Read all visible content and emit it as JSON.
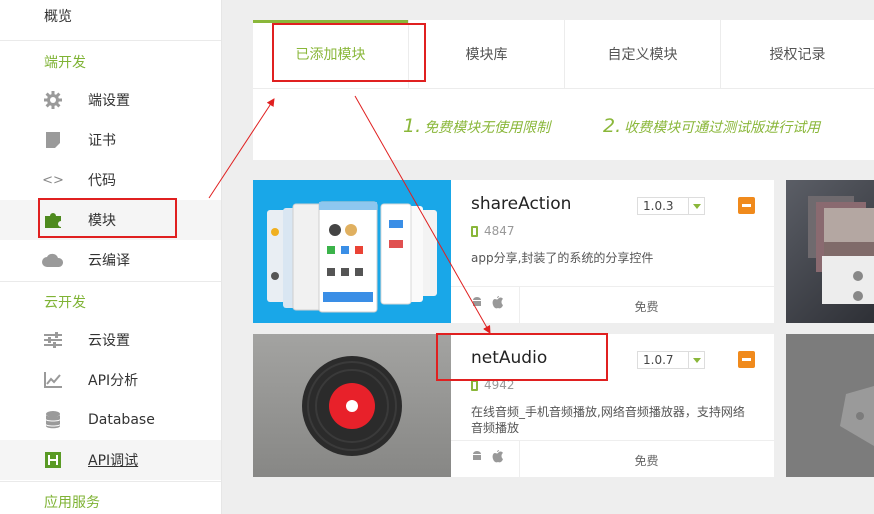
{
  "sidebar": {
    "top_item": "概览",
    "sections": {
      "device": "端开发",
      "cloud": "云开发",
      "services": "应用服务"
    },
    "items": [
      {
        "label": "端设置",
        "icon": "gear-icon"
      },
      {
        "label": "证书",
        "icon": "certificate-icon"
      },
      {
        "label": "代码",
        "icon": "code-icon"
      },
      {
        "label": "模块",
        "icon": "puzzle-icon",
        "active": true
      },
      {
        "label": "云编译",
        "icon": "cloud-icon"
      },
      {
        "label": "云设置",
        "icon": "sliders-icon"
      },
      {
        "label": "API分析",
        "icon": "chart-icon"
      },
      {
        "label": "Database",
        "icon": "database-icon"
      },
      {
        "label": "API调试",
        "icon": "api-debug-icon"
      }
    ]
  },
  "tabs": [
    "已添加模块",
    "模块库",
    "自定义模块",
    "授权记录"
  ],
  "tips": [
    {
      "num": "1.",
      "text": "免费模块无使用限制"
    },
    {
      "num": "2.",
      "text": "收费模块可通过测试版进行试用"
    }
  ],
  "modules": [
    {
      "name": "shareAction",
      "version": "1.0.3",
      "downloads": "4847",
      "desc": "app分享,封装了的系统的分享控件",
      "price": "免费"
    },
    {
      "name": "netAudio",
      "version": "1.0.7",
      "downloads": "4942",
      "desc": "在线音频_手机音频播放,网络音频播放器，支持网络音频播放",
      "price": "免费"
    }
  ],
  "os_icons": [
    "android-icon",
    "apple-icon"
  ],
  "colors": {
    "accent": "#8ab73a",
    "highlight": "#e02020",
    "orange": "#f08a1c"
  }
}
